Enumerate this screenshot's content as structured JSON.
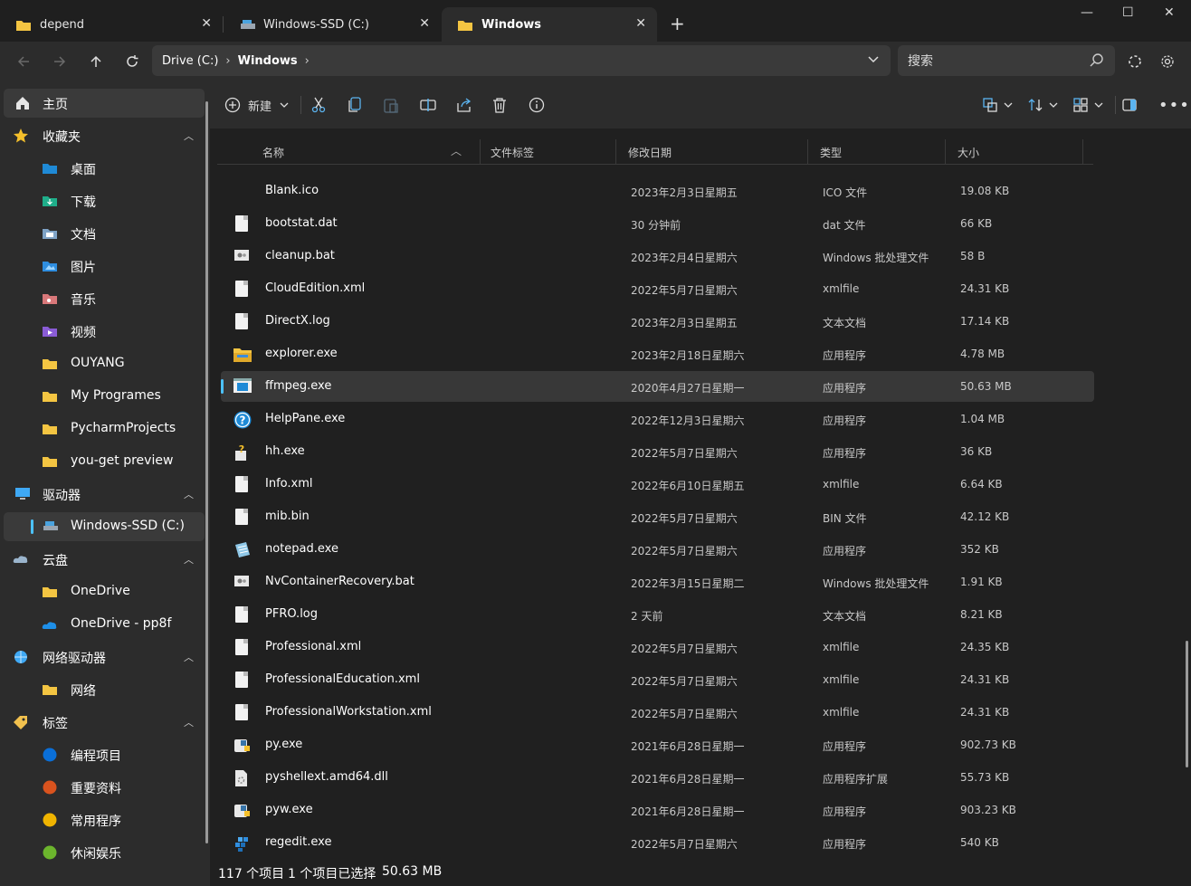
{
  "tabs": [
    {
      "label": "depend",
      "icon": "folder-icon"
    },
    {
      "label": "Windows-SSD (C:)",
      "icon": "drive-icon"
    },
    {
      "label": "Windows",
      "icon": "folder-icon"
    }
  ],
  "window_controls": {
    "minimize": "—",
    "maximize": "☐",
    "close": "✕"
  },
  "nav": {
    "breadcrumb": [
      "Drive (C:)",
      "Windows"
    ],
    "search_placeholder": "搜索"
  },
  "sidebar": {
    "home": "主页",
    "favorites": {
      "label": "收藏夹",
      "items": [
        "桌面",
        "下载",
        "文档",
        "图片",
        "音乐",
        "视频",
        "OUYANG",
        "My Programes",
        "PycharmProjects",
        "you-get preview"
      ]
    },
    "drives": {
      "label": "驱动器",
      "items": [
        "Windows-SSD (C:)"
      ]
    },
    "cloud": {
      "label": "云盘",
      "items": [
        "OneDrive",
        "OneDrive - pp8f"
      ]
    },
    "network_drives": {
      "label": "网络驱动器",
      "items": [
        "网络"
      ]
    },
    "tags": {
      "label": "标签",
      "items": [
        {
          "label": "编程项目",
          "color": "#0a6fd8"
        },
        {
          "label": "重要资料",
          "color": "#d9531e"
        },
        {
          "label": "常用程序",
          "color": "#f0b400"
        },
        {
          "label": "休闲娱乐",
          "color": "#6cb52d"
        }
      ]
    }
  },
  "toolbar": {
    "new_label": "新建"
  },
  "columns": {
    "name": "名称",
    "tags": "文件标签",
    "modified": "修改日期",
    "type": "类型",
    "size": "大小"
  },
  "files": [
    {
      "name": "Blank.ico",
      "date": "2023年2月3日星期五",
      "type": "ICO 文件",
      "size": "19.08 KB",
      "icon": "none"
    },
    {
      "name": "bootstat.dat",
      "date": "30 分钟前",
      "type": "dat 文件",
      "size": "66 KB",
      "icon": "doc"
    },
    {
      "name": "cleanup.bat",
      "date": "2023年2月4日星期六",
      "type": "Windows 批处理文件",
      "size": "58 B",
      "icon": "bat"
    },
    {
      "name": "CloudEdition.xml",
      "date": "2022年5月7日星期六",
      "type": "xmlfile",
      "size": "24.31 KB",
      "icon": "doc"
    },
    {
      "name": "DirectX.log",
      "date": "2023年2月3日星期五",
      "type": "文本文档",
      "size": "17.14 KB",
      "icon": "doc"
    },
    {
      "name": "explorer.exe",
      "date": "2023年2月18日星期六",
      "type": "应用程序",
      "size": "4.78 MB",
      "icon": "folder"
    },
    {
      "name": "ffmpeg.exe",
      "date": "2020年4月27日星期一",
      "type": "应用程序",
      "size": "50.63 MB",
      "icon": "app",
      "selected": true
    },
    {
      "name": "HelpPane.exe",
      "date": "2022年12月3日星期六",
      "type": "应用程序",
      "size": "1.04 MB",
      "icon": "help"
    },
    {
      "name": "hh.exe",
      "date": "2022年5月7日星期六",
      "type": "应用程序",
      "size": "36 KB",
      "icon": "hh"
    },
    {
      "name": "Info.xml",
      "date": "2022年6月10日星期五",
      "type": "xmlfile",
      "size": "6.64 KB",
      "icon": "doc"
    },
    {
      "name": "mib.bin",
      "date": "2022年5月7日星期六",
      "type": "BIN 文件",
      "size": "42.12 KB",
      "icon": "doc"
    },
    {
      "name": "notepad.exe",
      "date": "2022年5月7日星期六",
      "type": "应用程序",
      "size": "352 KB",
      "icon": "notepad"
    },
    {
      "name": "NvContainerRecovery.bat",
      "date": "2022年3月15日星期二",
      "type": "Windows 批处理文件",
      "size": "1.91 KB",
      "icon": "bat"
    },
    {
      "name": "PFRO.log",
      "date": "2 天前",
      "type": "文本文档",
      "size": "8.21 KB",
      "icon": "doc"
    },
    {
      "name": "Professional.xml",
      "date": "2022年5月7日星期六",
      "type": "xmlfile",
      "size": "24.35 KB",
      "icon": "doc"
    },
    {
      "name": "ProfessionalEducation.xml",
      "date": "2022年5月7日星期六",
      "type": "xmlfile",
      "size": "24.31 KB",
      "icon": "doc"
    },
    {
      "name": "ProfessionalWorkstation.xml",
      "date": "2022年5月7日星期六",
      "type": "xmlfile",
      "size": "24.31 KB",
      "icon": "doc"
    },
    {
      "name": "py.exe",
      "date": "2021年6月28日星期一",
      "type": "应用程序",
      "size": "902.73 KB",
      "icon": "python"
    },
    {
      "name": "pyshellext.amd64.dll",
      "date": "2021年6月28日星期一",
      "type": "应用程序扩展",
      "size": "55.73 KB",
      "icon": "dll"
    },
    {
      "name": "pyw.exe",
      "date": "2021年6月28日星期一",
      "type": "应用程序",
      "size": "903.23 KB",
      "icon": "python"
    },
    {
      "name": "regedit.exe",
      "date": "2022年5月7日星期六",
      "type": "应用程序",
      "size": "540 KB",
      "icon": "regedit"
    }
  ],
  "status": {
    "count": "117 个项目",
    "selected": "1 个项目已选择",
    "size": "50.63 MB"
  }
}
